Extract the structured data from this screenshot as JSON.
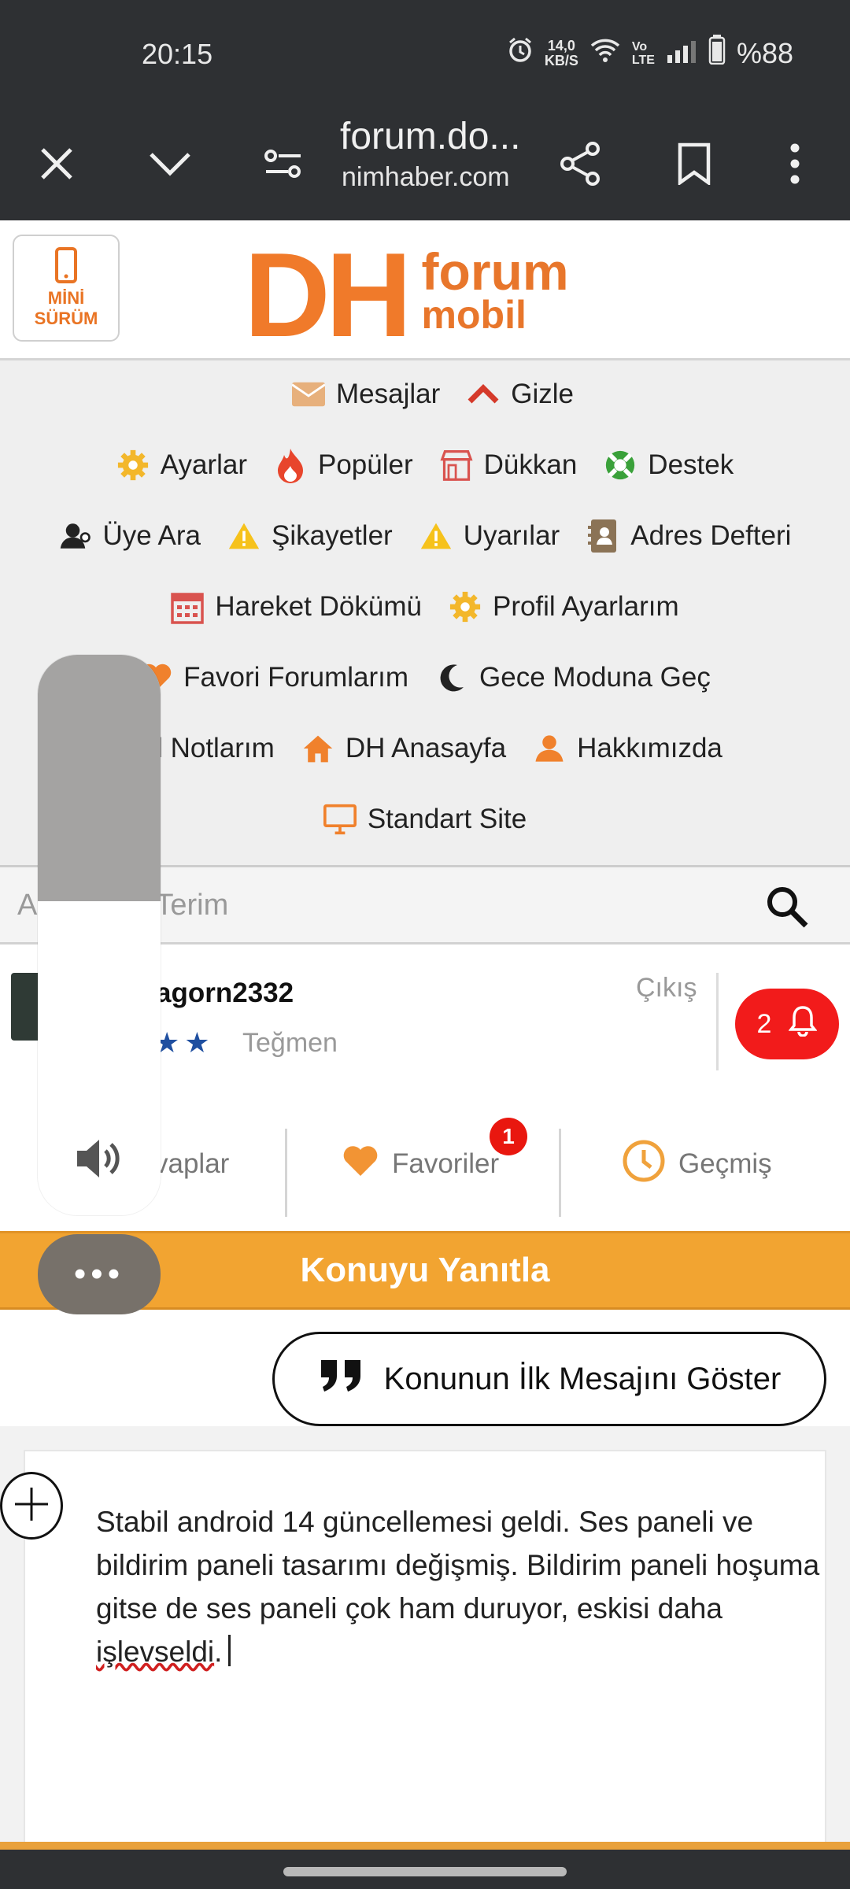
{
  "status_bar": {
    "time": "20:15",
    "net_speed_value": "14,0",
    "net_speed_unit": "KB/S",
    "volte_top": "Vo",
    "volte_bottom": "LTE",
    "battery": "%88",
    "icons": [
      "alarm-icon",
      "wifi-icon",
      "signal-icon",
      "battery-icon"
    ]
  },
  "browser": {
    "title": "forum.do...",
    "domain": "nimhaber.com",
    "icons": [
      "close-icon",
      "chevron-down-icon",
      "page-info-icon",
      "share-icon",
      "bookmark-icon",
      "more-vert-icon"
    ]
  },
  "header": {
    "mini_line1": "MİNİ",
    "mini_line2": "SÜRÜM",
    "logo_dh": "DH",
    "logo_forum": "forum",
    "logo_mobil": "mobil",
    "brand_color": "#f07a2a"
  },
  "menu": {
    "row1": [
      {
        "label": "Mesajlar",
        "icon": "envelope-icon"
      },
      {
        "label": "Gizle",
        "icon": "chevron-up-icon"
      }
    ],
    "row2": [
      {
        "label": "Ayarlar",
        "icon": "gear-icon"
      },
      {
        "label": "Popüler",
        "icon": "fire-icon"
      },
      {
        "label": "Dükkan",
        "icon": "store-icon"
      },
      {
        "label": "Destek",
        "icon": "lifebuoy-icon"
      }
    ],
    "row3": [
      {
        "label": "Üye Ara",
        "icon": "user-search-icon"
      },
      {
        "label": "Şikayetler",
        "icon": "warning-icon"
      },
      {
        "label": "Uyarılar",
        "icon": "warning-icon"
      },
      {
        "label": "Adres Defteri",
        "icon": "address-book-icon"
      }
    ],
    "row4": [
      {
        "label": "Hareket Dökümü",
        "icon": "calendar-icon"
      },
      {
        "label": "Profil Ayarlarım",
        "icon": "gear-icon"
      }
    ],
    "row5": [
      {
        "label": "Favori Forumlarım",
        "icon": "heart-icon"
      },
      {
        "label": "Gece Moduna Geç",
        "icon": "moon-icon"
      }
    ],
    "row6": [
      {
        "label": "sel Notlarım",
        "icon": "note-icon"
      },
      {
        "label": "DH Anasayfa",
        "icon": "home-icon"
      },
      {
        "label": "Hakkımızda",
        "icon": "user-icon"
      }
    ],
    "row7": [
      {
        "label": "Standart Site",
        "icon": "monitor-icon"
      }
    ]
  },
  "search": {
    "placeholder_visible": "A",
    "placeholder_rest": "Terim",
    "icon": "search-icon"
  },
  "user": {
    "name": "agorn2332",
    "rank": "Teğmen",
    "stars": 2,
    "logout": "Çıkış",
    "notification_count": "2"
  },
  "tabs": {
    "replies": "vaplar",
    "favorites": "Favoriler",
    "favorites_badge": "1",
    "history": "Geçmiş"
  },
  "reply": {
    "banner": "Konuyu Yanıtla",
    "show_first_message": "Konunun İlk Mesajını Göster",
    "editor_text_before": "Stabil android 14 güncellemesi geldi. Ses paneli ve bildirim paneli tasarımı değişmiş. Bildirim paneli hoşuma gitse de ses paneli çok ham duruyor, eskisi daha ",
    "editor_misspelled": "işlevseldi",
    "editor_text_after": "."
  },
  "volume_panel": {
    "level": 0.44,
    "more_label": "•••"
  }
}
